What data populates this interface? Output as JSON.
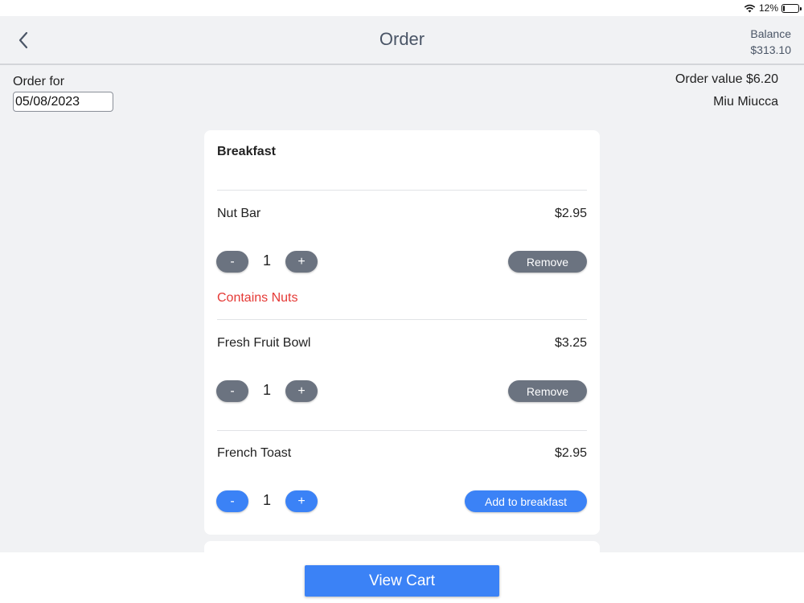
{
  "status_bar": {
    "battery": "12%",
    "battery_level": 0.12
  },
  "nav": {
    "title": "Order",
    "balance_label": "Balance",
    "balance_value": "$313.10",
    "back_icon": "chevron-left-icon"
  },
  "order": {
    "order_for_label": "Order for",
    "date": "05/08/2023",
    "order_value": "Order value $6.20",
    "customer": "Miu Miucca"
  },
  "menu": {
    "category": "Breakfast",
    "items": [
      {
        "name": "Nut Bar",
        "price": "$2.95",
        "qty": "1",
        "action": "Remove",
        "warning": "Contains Nuts"
      },
      {
        "name": "Fresh Fruit Bowl",
        "price": "$3.25",
        "qty": "1",
        "action": "Remove"
      },
      {
        "name": "French Toast",
        "price": "$2.95",
        "qty": "1",
        "action": "Add to breakfast"
      }
    ],
    "minus": "-",
    "plus": "+"
  },
  "footer": {
    "view_cart": "View Cart"
  },
  "colors": {
    "accent": "#3b82f6",
    "gray_button": "#6b7380",
    "warning": "#e53935"
  }
}
